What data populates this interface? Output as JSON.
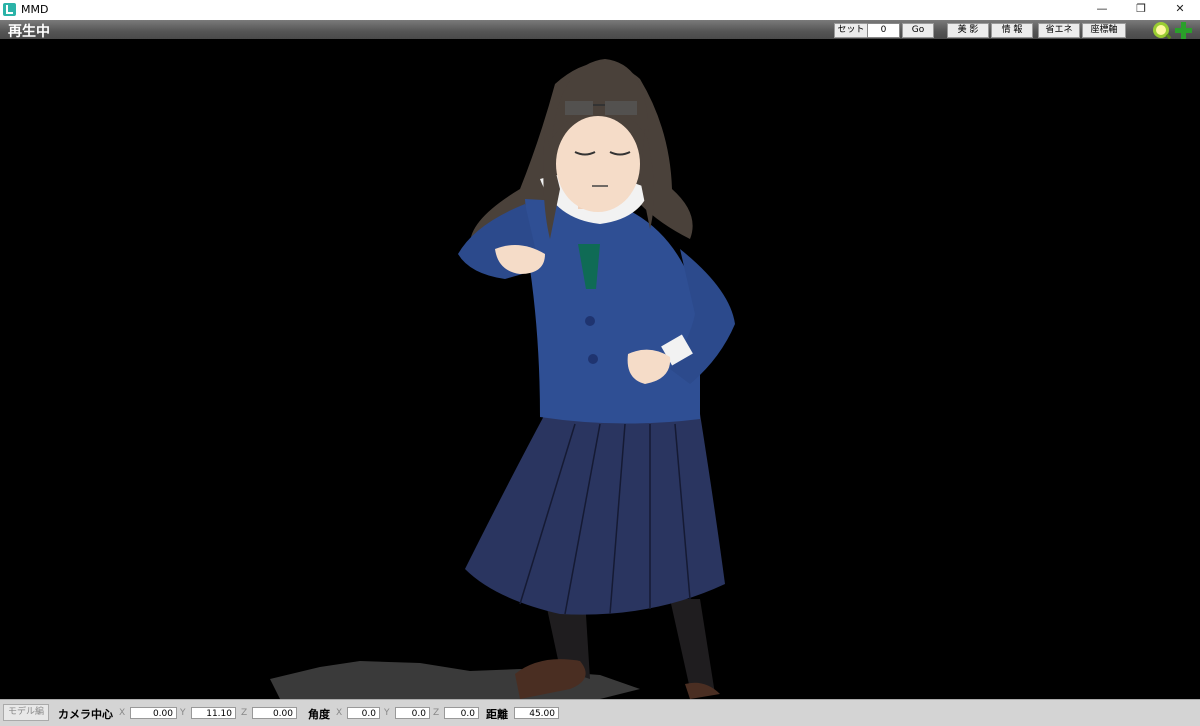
{
  "window": {
    "title": "MMD",
    "minimize": "—",
    "restore": "❐",
    "close": "✕"
  },
  "status": {
    "text": "再生中"
  },
  "toolbar": {
    "set_label": "セット",
    "frame_value": "0",
    "go_label": "Go",
    "beauty_label": "美 影",
    "info_label": "情 報",
    "eco_label": "省エネ",
    "axis_label": "座標軸"
  },
  "icons": {
    "search": "zoom-icon",
    "add": "add-icon"
  },
  "bottom": {
    "mode_label": "モデル編",
    "camera_center_label": "カメラ中心",
    "camera_center": {
      "x": "0.00",
      "y": "11.10",
      "z": "0.00"
    },
    "angle_label": "角度",
    "angle": {
      "x": "0.0",
      "y": "0.0",
      "z": "0.0"
    },
    "distance_label": "距離",
    "distance": "45.00",
    "axis_x": "X",
    "axis_y": "Y",
    "axis_z": "Z"
  },
  "colors": {
    "viewport_bg": "#000000",
    "blazer": "#2f4f94",
    "skirt": "#2a3560",
    "hair": "#4a413a"
  }
}
